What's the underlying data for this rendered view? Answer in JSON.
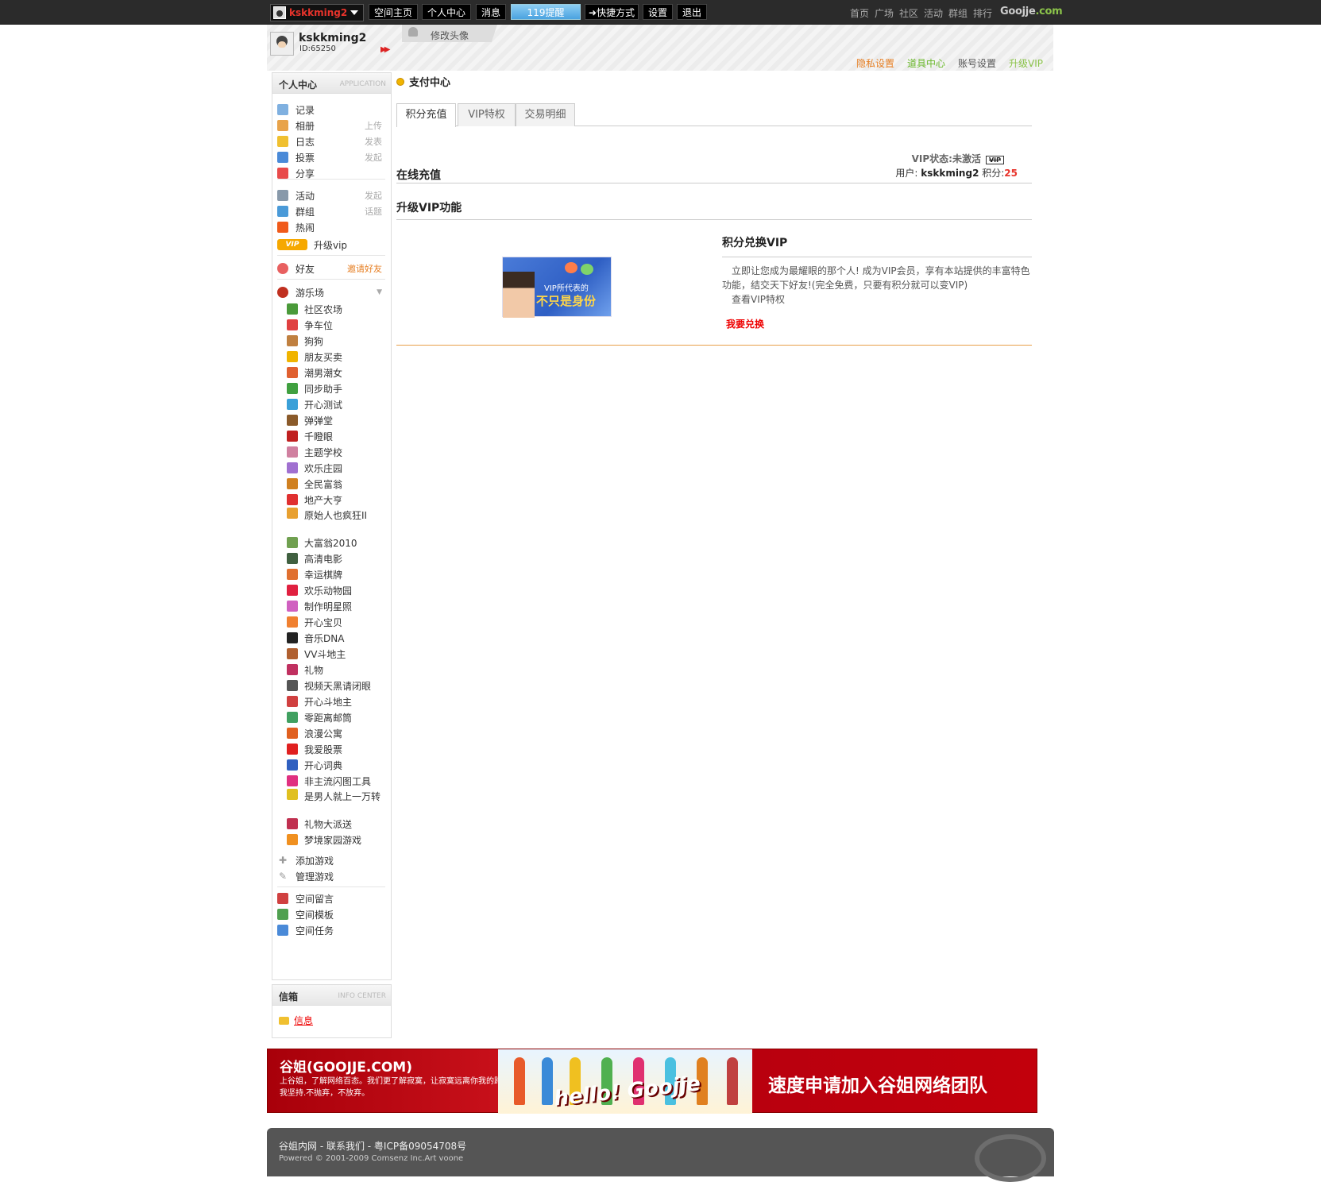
{
  "topbar": {
    "username": "kskkming2",
    "nav": [
      "空间主页",
      "个人中心",
      "消息",
      "119提醒",
      "快捷方式",
      "设置",
      "退出"
    ],
    "right_links": [
      "首页",
      "广场",
      "社区",
      "活动",
      "群组",
      "排行"
    ],
    "brand": "Goojje",
    "brand_suffix": ".com"
  },
  "profile": {
    "name": "kskkming2",
    "id": "ID:65250",
    "avatar_tab": "修改头像",
    "links": [
      {
        "label": "隐私设置",
        "color": "#e67e22"
      },
      {
        "label": "道具中心",
        "color": "#6bb82c"
      },
      {
        "label": "账号设置",
        "color": "#555555"
      },
      {
        "label": "升级VIP",
        "color": "#8bc34a"
      }
    ]
  },
  "sidebar": {
    "title": "个人中心",
    "title_en": "APPLICATION",
    "items": [
      {
        "label": "记录",
        "extra": "",
        "icon": "chat-icon",
        "color": "#7fb0e0"
      },
      {
        "label": "相册",
        "extra": "上传",
        "icon": "photo-icon",
        "color": "#e8a34a"
      },
      {
        "label": "日志",
        "extra": "发表",
        "icon": "blog-icon",
        "color": "#f0c030"
      },
      {
        "label": "投票",
        "extra": "发起",
        "icon": "poll-icon",
        "color": "#4a8ad8"
      },
      {
        "label": "分享",
        "extra": "",
        "icon": "heart-icon",
        "color": "#e84a4a"
      },
      {
        "label": "活动",
        "extra": "发起",
        "icon": "calendar-icon",
        "color": "#8899aa"
      },
      {
        "label": "群组",
        "extra": "话题",
        "icon": "group-icon",
        "color": "#4a9ad8"
      },
      {
        "label": "热闹",
        "extra": "",
        "icon": "fire-icon",
        "color": "#f05a1a"
      }
    ],
    "vip_label": "升级vip",
    "vip_badge": "VIP",
    "friends": "好友",
    "invite": "邀请好友",
    "playground": "游乐场",
    "games": [
      {
        "label": "社区农场",
        "color": "#4a9a3a"
      },
      {
        "label": "争车位",
        "color": "#e04040"
      },
      {
        "label": "狗狗",
        "color": "#c08040"
      },
      {
        "label": "朋友买卖",
        "color": "#f0b400"
      },
      {
        "label": "潮男潮女",
        "color": "#e06030"
      },
      {
        "label": "同步助手",
        "color": "#40a040"
      },
      {
        "label": "开心测试",
        "color": "#3aa0d8"
      },
      {
        "label": "弹弹堂",
        "color": "#8a5a2a"
      },
      {
        "label": "千瞪眼",
        "color": "#c02020"
      },
      {
        "label": "主题学校",
        "color": "#d080a0"
      },
      {
        "label": "欢乐庄园",
        "color": "#a070d0"
      },
      {
        "label": "全民富翁",
        "color": "#d08020"
      },
      {
        "label": "地产大亨",
        "color": "#e03030"
      },
      {
        "label": "原始人也疯狂II",
        "color": "#e8a030"
      },
      {
        "label": "大富翁2010",
        "color": "#70a050"
      },
      {
        "label": "高清电影",
        "color": "#406040"
      },
      {
        "label": "幸运棋牌",
        "color": "#e07030"
      },
      {
        "label": "欢乐动物园",
        "color": "#e02040"
      },
      {
        "label": "制作明星照",
        "color": "#d060c0"
      },
      {
        "label": "开心宝贝",
        "color": "#f08030"
      },
      {
        "label": "音乐DNA",
        "color": "#222222"
      },
      {
        "label": "VV斗地主",
        "color": "#b06030"
      },
      {
        "label": "礼物",
        "color": "#c03060"
      },
      {
        "label": "视频天黑请闭眼",
        "color": "#555555"
      },
      {
        "label": "开心斗地主",
        "color": "#d04040"
      },
      {
        "label": "零距离邮筒",
        "color": "#40a060"
      },
      {
        "label": "浪漫公寓",
        "color": "#e06020"
      },
      {
        "label": "我爱股票",
        "color": "#e02020"
      },
      {
        "label": "开心词典",
        "color": "#3060c0"
      },
      {
        "label": "非主流闪图工具",
        "color": "#e03080"
      },
      {
        "label": "是男人就上一万转",
        "color": "#e0c020"
      },
      {
        "label": "礼物大派送",
        "color": "#c03050"
      },
      {
        "label": "梦境家园游戏",
        "color": "#f09020"
      }
    ],
    "add_game": "添加游戏",
    "manage_game": "管理游戏",
    "bottom": [
      {
        "label": "空间留言",
        "color": "#d04040"
      },
      {
        "label": "空间模板",
        "color": "#50a050"
      },
      {
        "label": "空间任务",
        "color": "#4a8ad8"
      }
    ]
  },
  "mailbox": {
    "title": "信箱",
    "title_en": "INFO CENTER",
    "link": "信息"
  },
  "main": {
    "title": "支付中心",
    "tabs": [
      "积分充值",
      "VIP特权",
      "交易明细"
    ],
    "section1": "在线充值",
    "vip_status": "VIP状态:未激活",
    "vip_badge": "VIP",
    "user_prefix": "用户:",
    "user_name": "kskkming2",
    "points_label": "积分:",
    "points": "25",
    "section2": "升级VIP功能",
    "banner_line1": "VIP所代表的",
    "banner_line2": "不只是身份",
    "exchange_title": "积分兑换VIP",
    "exchange_desc": "立即让您成为最耀眼的那个人! 成为VIP会员，享有本站提供的丰富特色功能，结交天下好友!(完全免费，只要有积分就可以变VIP)",
    "view_vip": "查看VIP特权",
    "exchange_button": "我要兑换"
  },
  "footer_banner": {
    "title": "谷姐(GOOJJE.COM)",
    "desc": "上谷姐，了解网络百态。我们更了解寂寞，让寂寞远离你我的路，我坚持.不抛弃，不放弃。",
    "hello": "hello! Goojje",
    "cta": "速度申请加入谷姐网络团队"
  },
  "footer": {
    "line1": "谷姐内网 - 联系我们    - 粤ICP备09054708号",
    "line2": "Powered © 2001-2009 Comsenz Inc.Art voone"
  }
}
